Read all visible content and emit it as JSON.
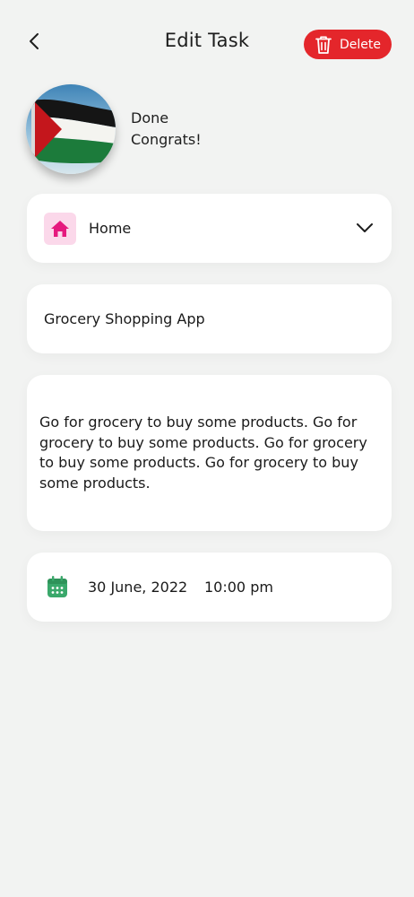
{
  "header": {
    "title": "Edit Task",
    "delete_label": "Delete",
    "back_icon": "chevron-left-icon",
    "delete_icon": "trash-icon",
    "delete_color": "#e4262b"
  },
  "profile": {
    "status_line1": "Done",
    "status_line2": "Congrats!",
    "avatar": "palestine-flag-image"
  },
  "category": {
    "label": "Home",
    "icon": "home-icon",
    "icon_color": "#e5197e",
    "icon_bg": "#fbd8ea"
  },
  "task": {
    "title": "Grocery Shopping App",
    "description": "Go for grocery to buy some products. Go for grocery to buy some products. Go for grocery to buy some products. Go for grocery to buy some products."
  },
  "schedule": {
    "date": "30 June, 2022",
    "time": "10:00 pm",
    "icon": "calendar-icon",
    "icon_color": "#3aa86b"
  }
}
